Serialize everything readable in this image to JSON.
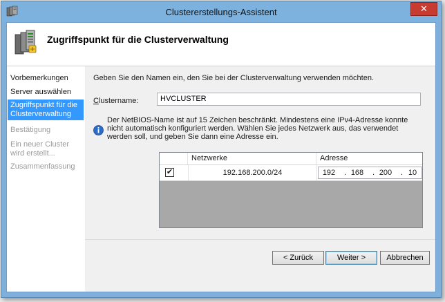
{
  "window": {
    "title": "Clustererstellungs-Assistent",
    "close_label": "✕"
  },
  "header": {
    "title": "Zugriffspunkt für die Clusterverwaltung",
    "icon": "cluster-servers-icon"
  },
  "sidebar": {
    "items": [
      {
        "label": "Vorbemerkungen",
        "state": "normal"
      },
      {
        "label": "Server auswählen",
        "state": "normal"
      },
      {
        "label": "Zugriffspunkt für die Clusterverwaltung",
        "state": "active"
      },
      {
        "label": "Bestätigung",
        "state": "disabled"
      },
      {
        "label": "Ein neuer Cluster wird erstellt...",
        "state": "disabled"
      },
      {
        "label": "Zusammenfassung",
        "state": "disabled"
      }
    ]
  },
  "main": {
    "intro": "Geben Sie den Namen ein, den Sie bei der Clusterverwaltung verwenden möchten.",
    "cluster_name_label_prefix": "C",
    "cluster_name_label_rest": "lustername:",
    "cluster_name_value": "HVCLUSTER",
    "info_text": "Der NetBIOS-Name ist auf 15 Zeichen beschränkt.  Mindestens eine IPv4-Adresse konnte nicht automatisch konfiguriert werden. Wählen Sie jedes Netzwerk aus, das verwendet werden soll, und geben Sie dann eine Adresse ein.",
    "table": {
      "columns": [
        "",
        "Netzwerke",
        "Adresse"
      ],
      "rows": [
        {
          "checked": true,
          "check_glyph": "✔",
          "network": "192.168.200.0/24",
          "address": [
            "192",
            "168",
            "200",
            "10"
          ]
        }
      ]
    }
  },
  "footer": {
    "back_label": "< Zurück",
    "next_label": "Weiter >",
    "cancel_label": "Abbrechen"
  },
  "colors": {
    "titlebar": "#7eb2de",
    "active_nav": "#3399ff",
    "close_button": "#c73b30"
  }
}
